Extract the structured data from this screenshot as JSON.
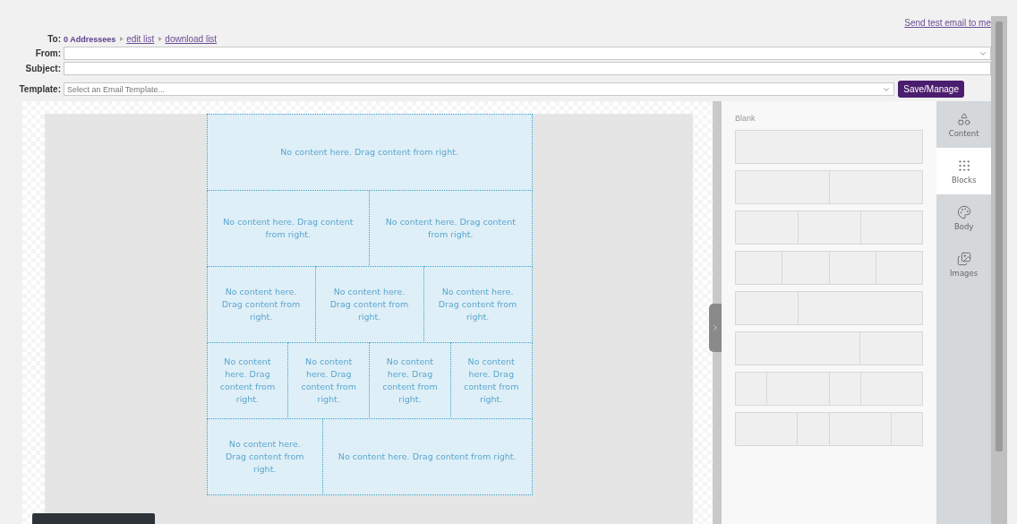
{
  "header": {
    "send_test": "Send test email to me",
    "to_label": "To:",
    "addressees": "0 Addressees",
    "links": [
      {
        "label": "edit list"
      },
      {
        "label": "download list"
      }
    ]
  },
  "fields": [
    {
      "label": "From:",
      "kind": "select"
    },
    {
      "label": "Subject:",
      "kind": "text"
    }
  ],
  "template": {
    "label": "Template:",
    "placeholder": "Select an Email Template...",
    "button": "Save/Manage"
  },
  "email_rows": [
    {
      "cells": [
        {
          "kind": "single",
          "text": "No content here. Drag content from right."
        }
      ]
    },
    {
      "cells": [
        {
          "kind": "single",
          "text": "No content here. Drag content from right."
        },
        {
          "kind": "single",
          "text": "No content here. Drag content from right."
        }
      ]
    },
    {
      "cells": [
        {
          "kind": "single",
          "text": "No content here. Drag content from right."
        },
        {
          "kind": "single",
          "text": "No content here. Drag content from right."
        },
        {
          "kind": "single",
          "text": "No content here. Drag content from right."
        }
      ]
    },
    {
      "cells": [
        {
          "kind": "single",
          "text": "No content here. Drag content from right."
        },
        {
          "kind": "single",
          "text": "No content here. Drag content from right."
        },
        {
          "kind": "single",
          "text": "No content here. Drag content from right."
        },
        {
          "kind": "single",
          "text": "No content here. Drag content from right."
        }
      ]
    },
    {
      "cells": [
        {
          "kind": "single",
          "text": "No content here. Drag content from right."
        },
        {
          "kind": "double",
          "text": "No content here. Drag content from right."
        }
      ]
    }
  ],
  "blocks_panel": {
    "title": "Blank",
    "blocks": [
      {
        "cells": [
          {
            "kind": "single"
          }
        ]
      },
      {
        "cells": [
          {
            "kind": "single"
          },
          {
            "kind": "single"
          }
        ]
      },
      {
        "cells": [
          {
            "kind": "single"
          },
          {
            "kind": "single"
          },
          {
            "kind": "single"
          }
        ]
      },
      {
        "cells": [
          {
            "kind": "single"
          },
          {
            "kind": "single"
          },
          {
            "kind": "single"
          },
          {
            "kind": "single"
          }
        ]
      },
      {
        "cells": [
          {
            "kind": "single"
          },
          {
            "kind": "double"
          }
        ]
      },
      {
        "cells": [
          {
            "kind": "double"
          },
          {
            "kind": "single"
          }
        ]
      },
      {
        "cells": [
          {
            "kind": "single"
          },
          {
            "kind": "double"
          },
          {
            "kind": "single"
          },
          {
            "kind": "double"
          }
        ]
      },
      {
        "cells": [
          {
            "kind": "double"
          },
          {
            "kind": "single"
          },
          {
            "kind": "double"
          },
          {
            "kind": "single"
          }
        ]
      }
    ]
  },
  "tabs": [
    {
      "label": "Content",
      "kind": "content",
      "selected": false
    },
    {
      "label": "Blocks",
      "kind": "blocks",
      "selected": true
    },
    {
      "label": "Body",
      "kind": "body",
      "selected": false
    },
    {
      "label": "Images",
      "kind": "images",
      "selected": false
    }
  ]
}
